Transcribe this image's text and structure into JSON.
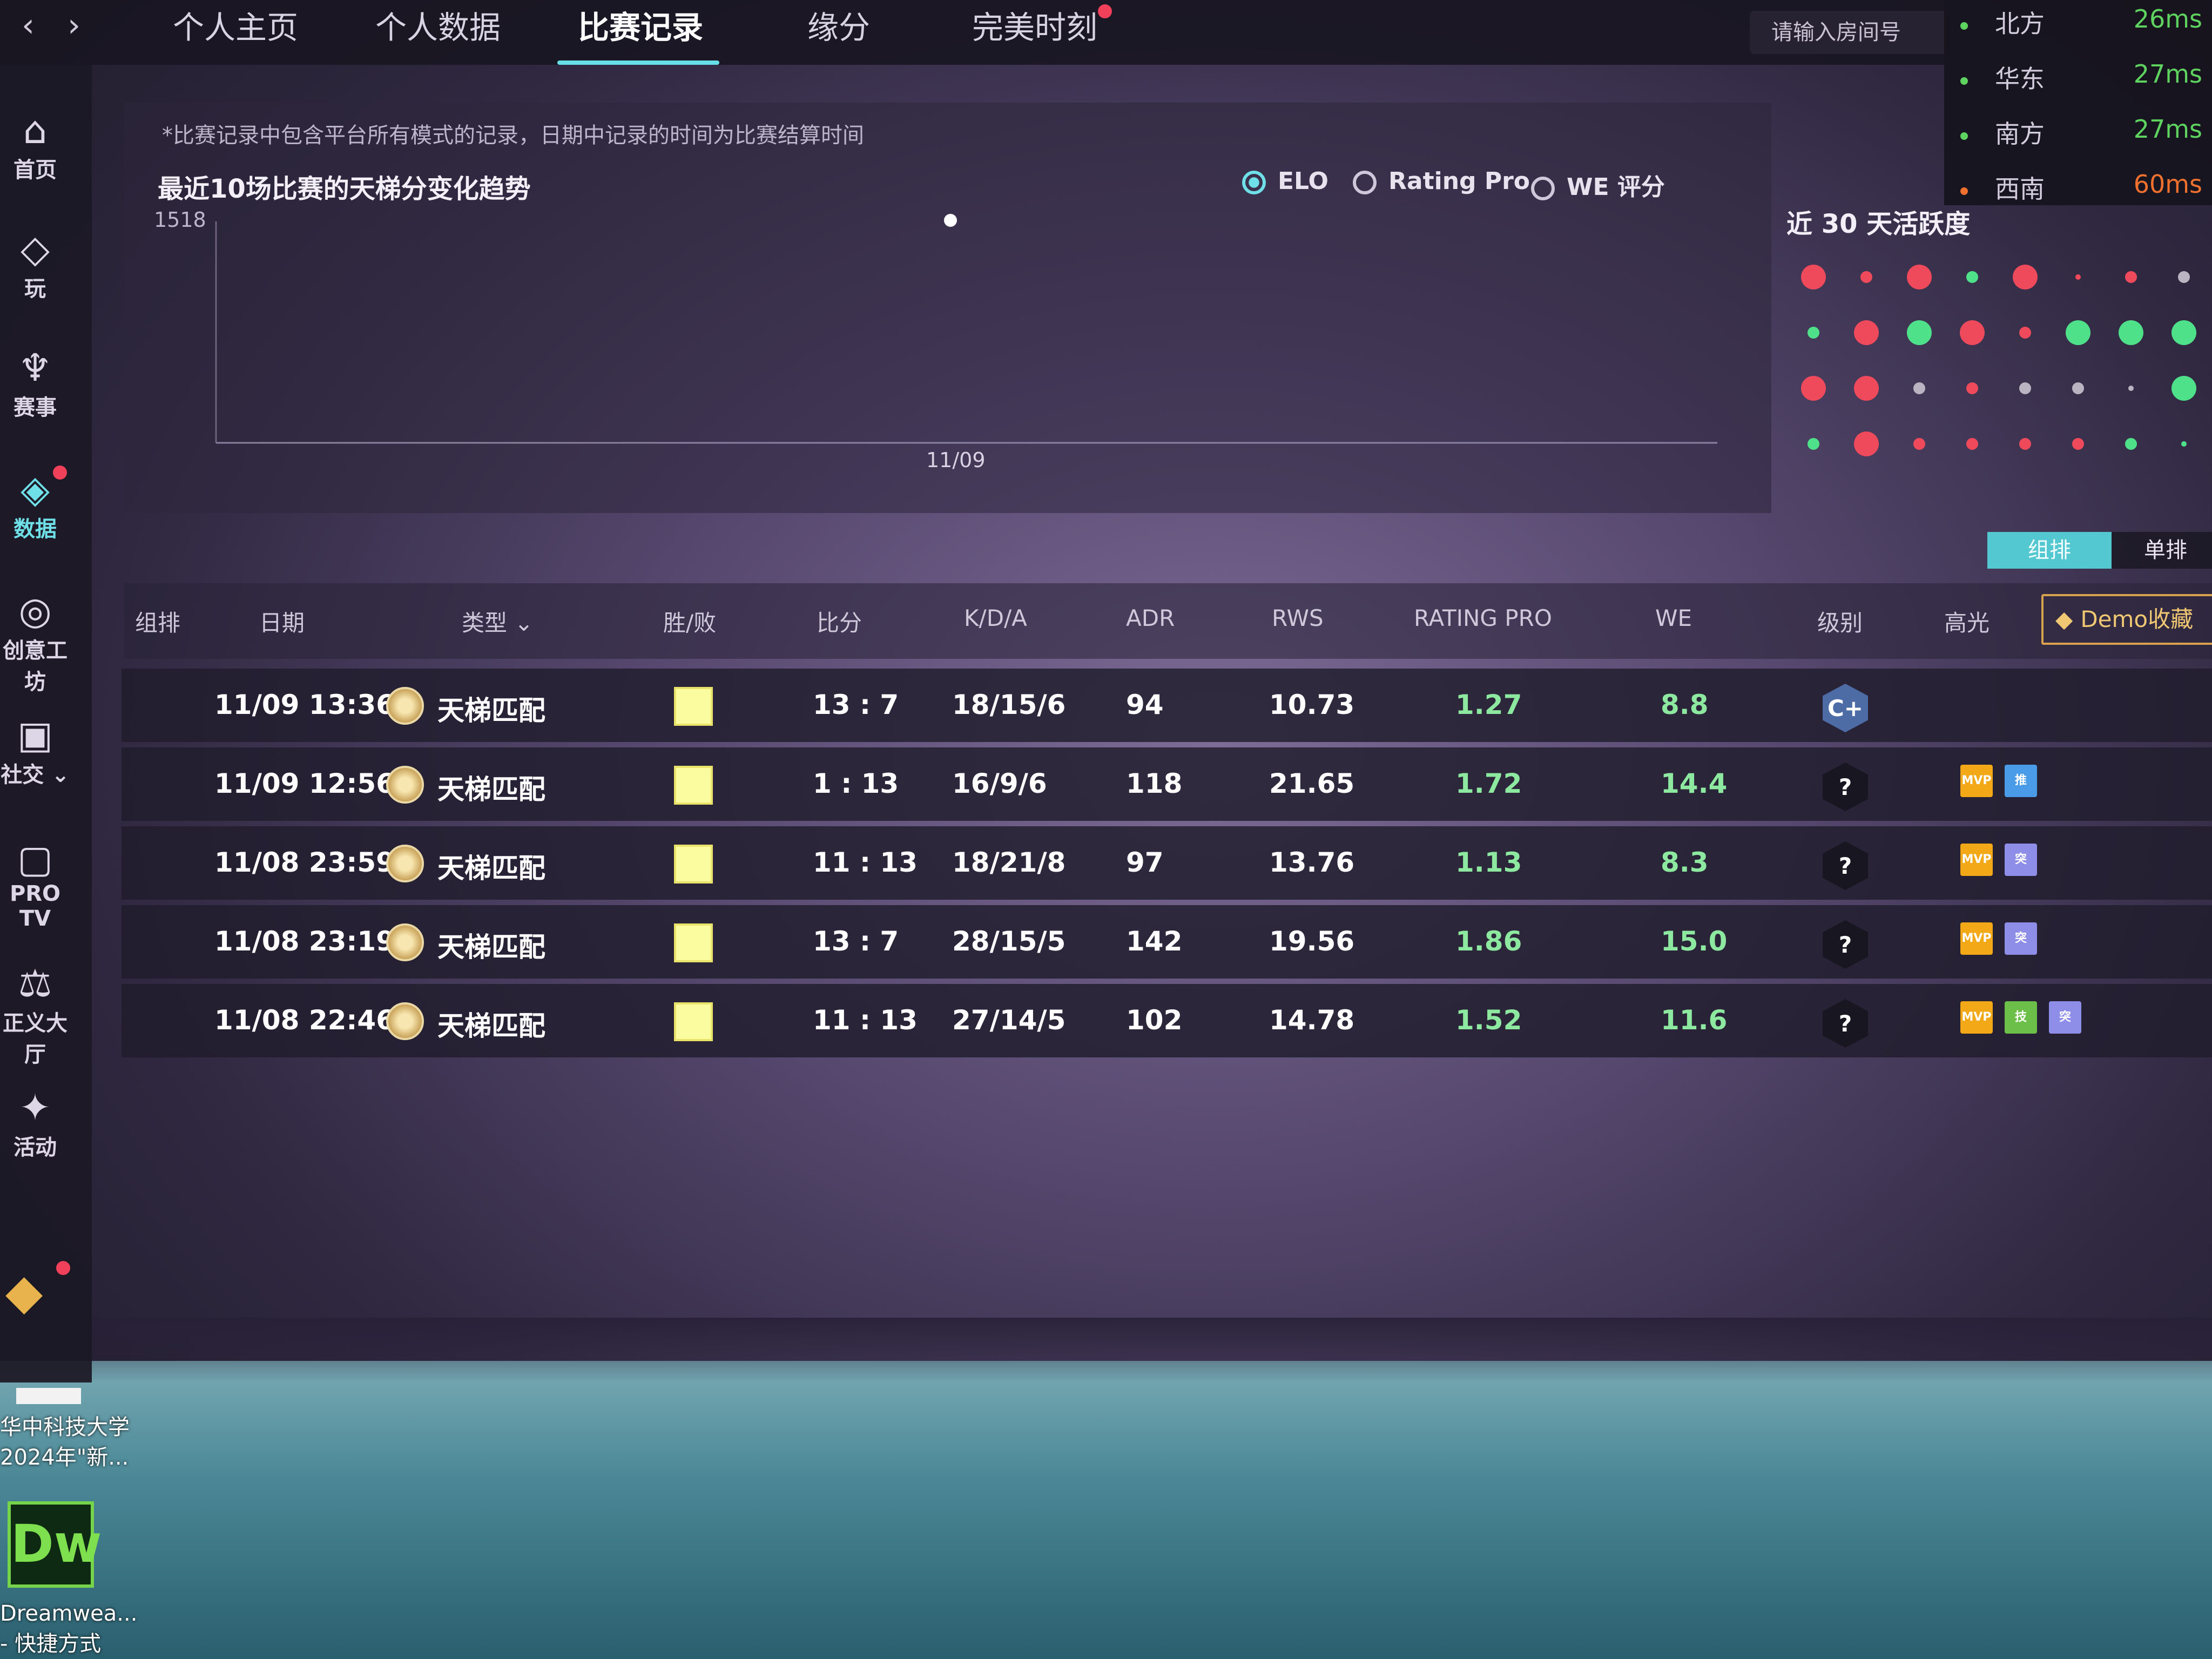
{
  "nav": {
    "back": "‹",
    "forward": "›",
    "tabs": [
      "个人主页",
      "个人数据",
      "比赛记录",
      "缘分",
      "完美时刻"
    ],
    "room_placeholder": "请输入房间号"
  },
  "servers": [
    {
      "name": "北方",
      "ping": "26ms",
      "color": "#5fd35f"
    },
    {
      "name": "华东",
      "ping": "27ms",
      "color": "#5fd35f"
    },
    {
      "name": "南方",
      "ping": "27ms",
      "color": "#5fd35f"
    },
    {
      "name": "西南",
      "ping": "60ms",
      "color": "#f07030"
    }
  ],
  "sidebar": [
    {
      "label": "首页",
      "icon": "home-icon",
      "glyph": "⌂"
    },
    {
      "label": "玩",
      "icon": "wifi-icon",
      "glyph": "◇"
    },
    {
      "label": "赛事",
      "icon": "trophy-icon",
      "glyph": "♆"
    },
    {
      "label": "数据",
      "icon": "data-icon",
      "glyph": "◈"
    },
    {
      "label": "创意工坊",
      "icon": "planet-icon",
      "glyph": "◎"
    },
    {
      "label": "社交 ⌄",
      "icon": "chat-icon",
      "glyph": "▣"
    },
    {
      "label": "PRO TV",
      "icon": "tv-icon",
      "glyph": "▢"
    },
    {
      "label": "正义大厅",
      "icon": "scales-icon",
      "glyph": "⚖"
    },
    {
      "label": "活动",
      "icon": "mascot-icon",
      "glyph": "✦"
    }
  ],
  "chart": {
    "note": "*比赛记录中包含平台所有模式的记录，日期中记录的时间为比赛结算时间",
    "title": "最近10场比赛的天梯分变化趋势",
    "options": [
      "ELO",
      "Rating Pro",
      "WE 评分"
    ],
    "selected": "ELO"
  },
  "chart_data": {
    "type": "scatter",
    "title": "最近10场比赛的天梯分变化趋势",
    "x": [
      "11/09"
    ],
    "series": [
      {
        "values": [
          1518
        ]
      }
    ],
    "ytick": "1518",
    "xtick": "11/09"
  },
  "activity": {
    "title": "近 30 天活跃度",
    "cells": [
      [
        "r3",
        "r1",
        "r3",
        "g1",
        "r3",
        "r0",
        "r1",
        "w1"
      ],
      [
        "g1",
        "r3",
        "g3",
        "r3",
        "r1",
        "g3",
        "g3",
        "g3"
      ],
      [
        "r3",
        "r3",
        "w1",
        "r1",
        "w1",
        "w1",
        "w0",
        "g3"
      ],
      [
        "g1",
        "r3",
        "r1",
        "r1",
        "r1",
        "r1",
        "g1",
        "g0"
      ]
    ]
  },
  "toggle": {
    "team": "组排",
    "solo": "单排"
  },
  "table": {
    "headers": [
      "组排",
      "日期",
      "类型 ⌄",
      "胜/败",
      "比分",
      "K/D/A",
      "ADR",
      "RWS",
      "RATING PRO",
      "WE",
      "级别",
      "高光"
    ],
    "demo": "Demo收藏",
    "rows": [
      {
        "date": "11/09 13:36",
        "type": "天梯匹配",
        "score": "13 : 7",
        "kda": "18/15/6",
        "adr": "94",
        "rws": "10.73",
        "rating": "1.27",
        "we": "8.8",
        "level": "C+",
        "highlights": []
      },
      {
        "date": "11/09 12:56",
        "type": "天梯匹配",
        "score": "1 : 13",
        "kda": "16/9/6",
        "adr": "118",
        "rws": "21.65",
        "rating": "1.72",
        "we": "14.4",
        "level": "?",
        "highlights": [
          "MVP",
          "推"
        ]
      },
      {
        "date": "11/08 23:59",
        "type": "天梯匹配",
        "score": "11 : 13",
        "kda": "18/21/8",
        "adr": "97",
        "rws": "13.76",
        "rating": "1.13",
        "we": "8.3",
        "level": "?",
        "highlights": [
          "MVP",
          "突"
        ]
      },
      {
        "date": "11/08 23:19",
        "type": "天梯匹配",
        "score": "13 : 7",
        "kda": "28/15/5",
        "adr": "142",
        "rws": "19.56",
        "rating": "1.86",
        "we": "15.0",
        "level": "?",
        "highlights": [
          "MVP",
          "突"
        ]
      },
      {
        "date": "11/08 22:46",
        "type": "天梯匹配",
        "score": "11 : 13",
        "kda": "27/14/5",
        "adr": "102",
        "rws": "14.78",
        "rating": "1.52",
        "we": "11.6",
        "level": "?",
        "highlights": [
          "MVP",
          "技",
          "突"
        ]
      }
    ]
  },
  "desktop": {
    "shortcut1": [
      "华中科技大学",
      "2024年\"新..."
    ],
    "dw_label": "Dw",
    "shortcut2": [
      "Dreamwea...",
      "- 快捷方式"
    ]
  }
}
